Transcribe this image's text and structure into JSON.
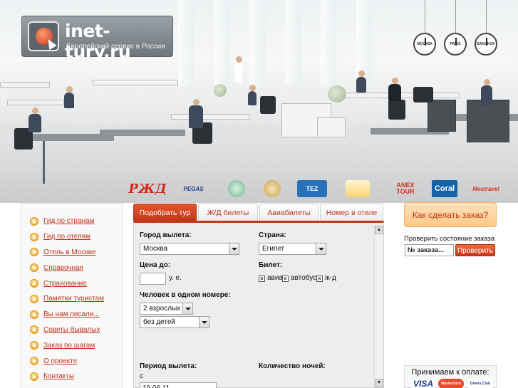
{
  "brand": {
    "title": "inet-tury.ru",
    "subtitle": "Европейский сервис в России"
  },
  "clocks": [
    "МОСКВА",
    "PARIS",
    "BANGKOK"
  ],
  "partners": {
    "rzd": "РЖД",
    "pegas": "PEGAS",
    "tez": "TEZ",
    "anex": "ANEX TOUR",
    "coral": "Coral",
    "mostravel": "Mostravel"
  },
  "sidebar": {
    "items": [
      {
        "label": "Гид по странам"
      },
      {
        "label": "Гид по отелям"
      },
      {
        "label": "Отель в Москве"
      },
      {
        "label": "Справочная"
      },
      {
        "label": "Страхование"
      },
      {
        "label": "Памятки туристам"
      },
      {
        "label": "Вы нам писали..."
      },
      {
        "label": "Советы бывалых"
      },
      {
        "label": "Заказ по шагам"
      },
      {
        "label": "О проекте"
      },
      {
        "label": "Контакты"
      }
    ]
  },
  "tabs": [
    {
      "label": "Подобрать тур",
      "active": true
    },
    {
      "label": "Ж/Д билеты"
    },
    {
      "label": "Авиабилеты"
    },
    {
      "label": "Номер в отеле"
    }
  ],
  "form": {
    "departure_label": "Город вылета:",
    "departure_value": "Москва",
    "country_label": "Страна:",
    "country_value": "Египет",
    "price_label": "Цена до:",
    "price_value": "",
    "price_unit": "у. е.",
    "ticket_label": "Билет:",
    "ticket_options": [
      "авиа",
      "автобус",
      "ж-д"
    ],
    "people_label": "Человек в одном номере:",
    "adults_value": "2 взрослых",
    "children_value": "без детей",
    "period_label": "Период вылета:",
    "period_from_label": "с",
    "period_from_value": "19.06.11",
    "nights_label": "Количество ночей:"
  },
  "right": {
    "howto_label": "Как сделать заказ?",
    "status_title": "Проверить состояние заказа",
    "order_placeholder": "№ заказа...",
    "check_button": "Проверить",
    "payment_title": "Принимаем к оплате:",
    "cards": [
      "VISA",
      "MasterCard",
      "Diners Club International"
    ]
  },
  "colors": {
    "accent": "#c5361a",
    "link": "#c2331a",
    "highlight_bg": "#ffd29a"
  }
}
